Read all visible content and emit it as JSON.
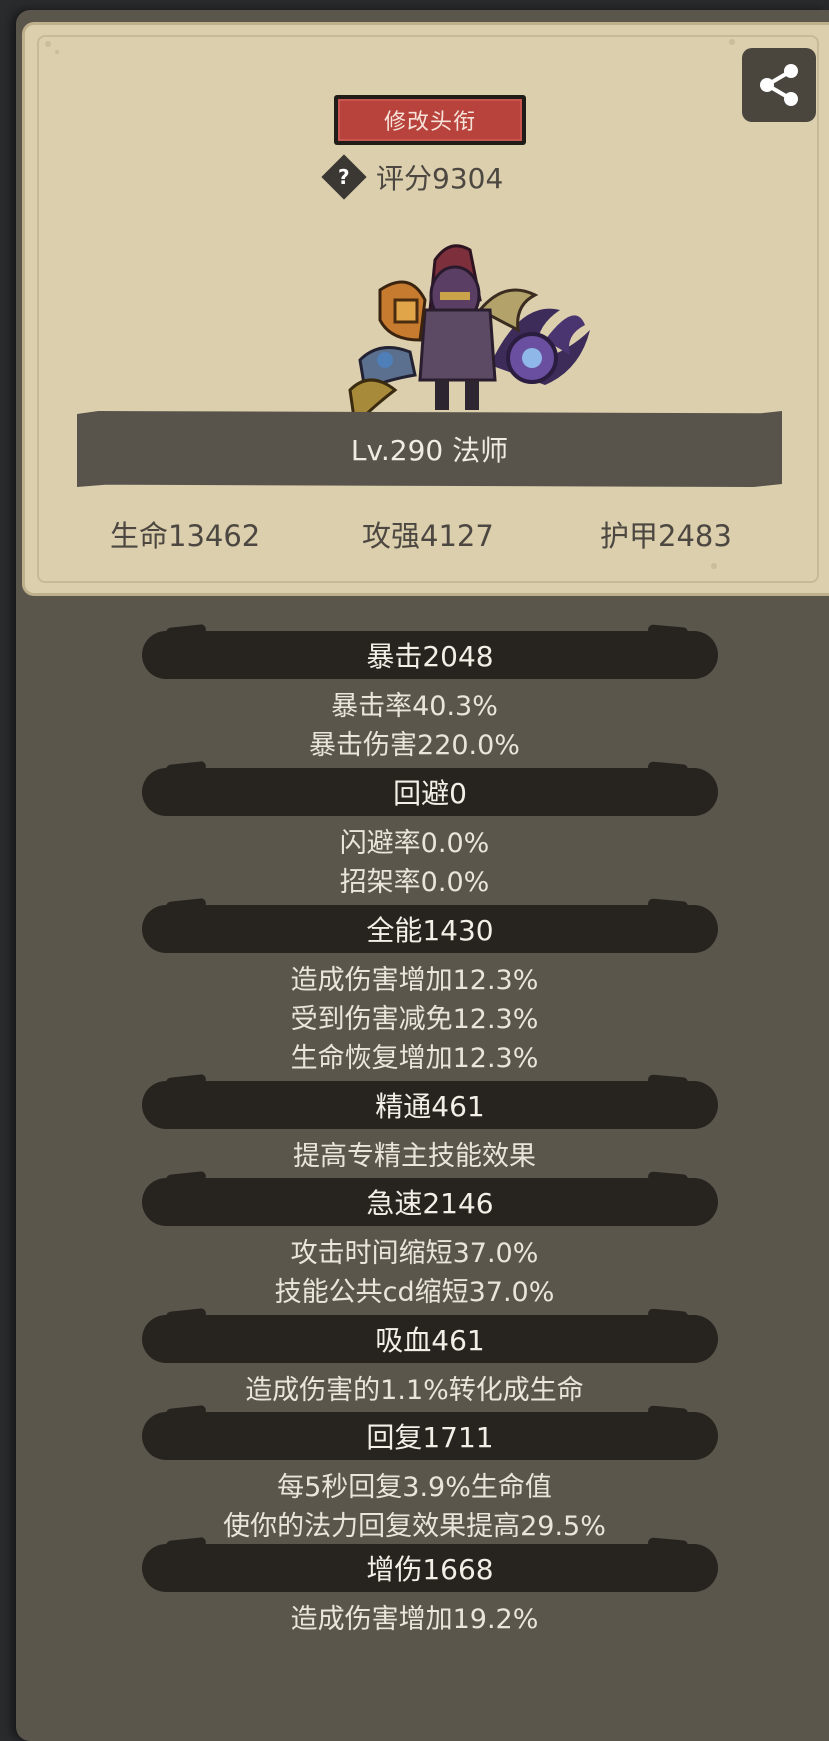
{
  "header": {
    "title_button": "修改头衔",
    "score": "评分9304",
    "level_class": "Lv.290 法师"
  },
  "main_stats": [
    "生命13462",
    "攻强4127",
    "护甲2483"
  ],
  "stat_groups": [
    {
      "name": "暴击2048",
      "details": [
        "暴击率40.3%",
        "暴击伤害220.0%"
      ]
    },
    {
      "name": "回避0",
      "details": [
        "闪避率0.0%",
        "招架率0.0%"
      ]
    },
    {
      "name": "全能1430",
      "details": [
        "造成伤害增加12.3%",
        "受到伤害减免12.3%",
        "生命恢复增加12.3%"
      ]
    },
    {
      "name": "精通461",
      "details": [
        "提高专精主技能效果"
      ]
    },
    {
      "name": "急速2146",
      "details": [
        "攻击时间缩短37.0%",
        "技能公共cd缩短37.0%"
      ]
    },
    {
      "name": "吸血461",
      "details": [
        "造成伤害的1.1%转化成生命"
      ]
    },
    {
      "name": "回复1711",
      "details": [
        "每5秒回复3.9%生命值",
        "使你的法力回复效果提高29.5%"
      ]
    },
    {
      "name": "增伤1668",
      "details": [
        "造成伤害增加19.2%"
      ]
    }
  ],
  "icons": {
    "share": "share-icon",
    "help": "question-icon"
  },
  "colors": {
    "card": "#dccfae",
    "panel": "#5b564c",
    "button_red": "#b8423c",
    "pill": "#272420"
  }
}
